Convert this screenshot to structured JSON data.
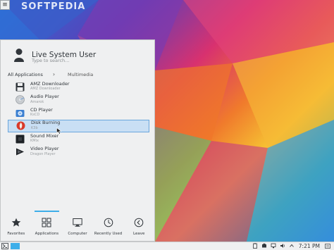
{
  "watermark": "SOFTPEDIA",
  "menu": {
    "user_name": "Live System User",
    "search_placeholder": "Type to search...",
    "breadcrumb": {
      "root": "All Applications",
      "separator": "›",
      "current": "Multimedia"
    },
    "items": [
      {
        "name": "AMZ Downloader",
        "sub": "AMZ Downloader",
        "icon": "disk-save-icon"
      },
      {
        "name": "Audio Player",
        "sub": "Amarok",
        "icon": "audio-cd-icon"
      },
      {
        "name": "CD Player",
        "sub": "KsCD",
        "icon": "cd-player-icon"
      },
      {
        "name": "Disk Burning",
        "sub": "K3b",
        "icon": "disc-burn-icon",
        "selected": true
      },
      {
        "name": "Sound Mixer",
        "sub": "KMix",
        "icon": "mixer-icon"
      },
      {
        "name": "Video Player",
        "sub": "Dragon Player",
        "icon": "video-player-icon"
      }
    ],
    "tabs": [
      {
        "label": "Favorites",
        "icon": "star-icon"
      },
      {
        "label": "Applications",
        "icon": "grid-icon",
        "active": true
      },
      {
        "label": "Computer",
        "icon": "monitor-icon"
      },
      {
        "label": "Recently Used",
        "icon": "clock-icon"
      },
      {
        "label": "Leave",
        "icon": "back-arrow-icon"
      }
    ]
  },
  "taskbar": {
    "clock": "7:21 PM"
  },
  "colors": {
    "accent": "#3daee9",
    "selection": "#c9dff4",
    "panel": "#eff0f1"
  }
}
